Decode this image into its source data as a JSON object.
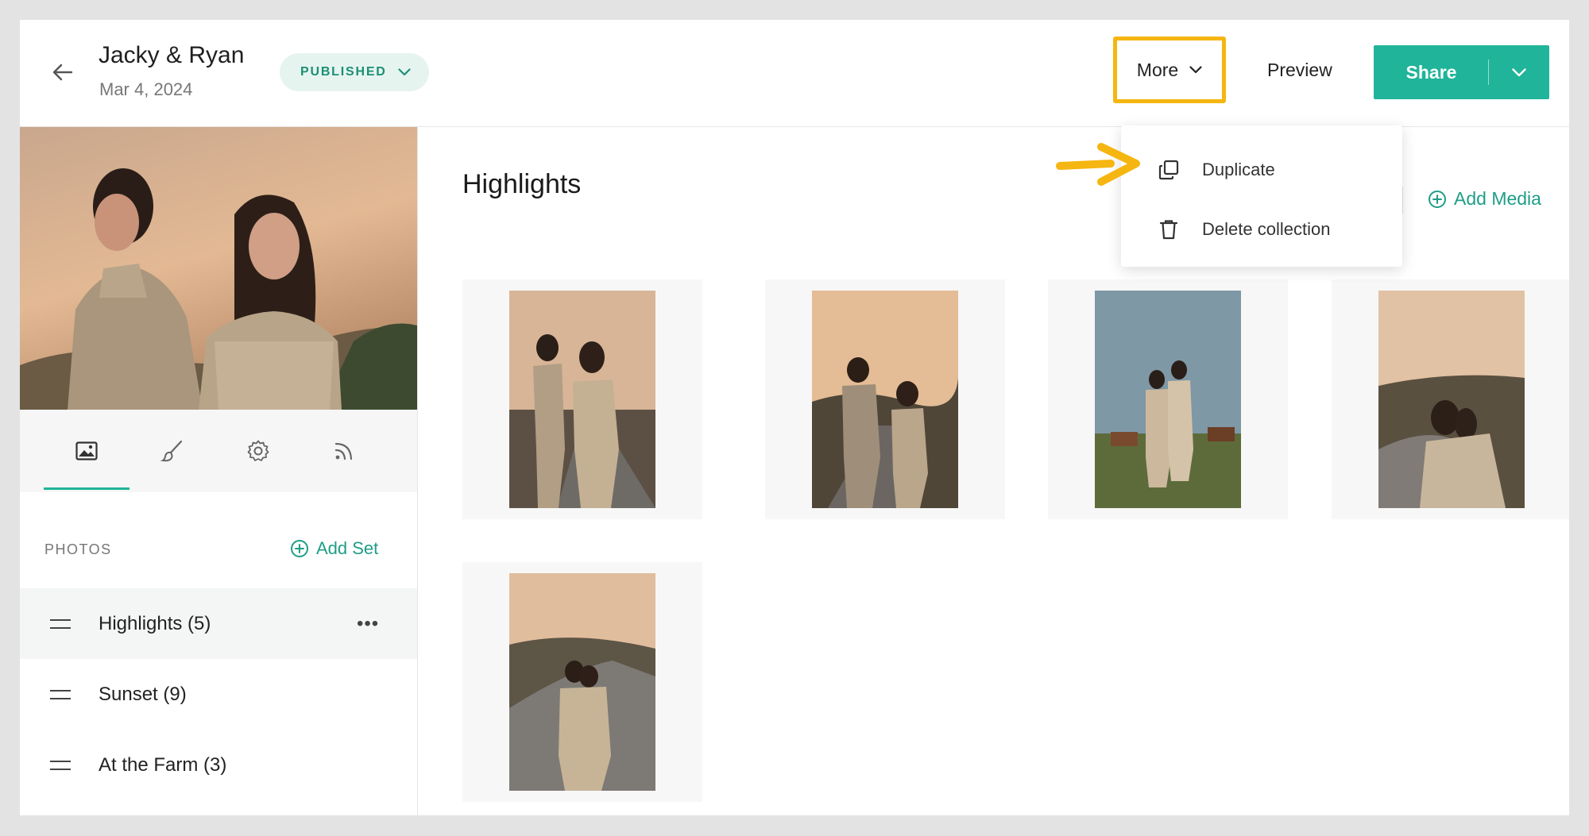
{
  "header": {
    "title": "Jacky & Ryan",
    "date": "Mar 4, 2024",
    "status": "PUBLISHED",
    "more_label": "More",
    "preview_label": "Preview",
    "share_label": "Share"
  },
  "more_menu": {
    "items": [
      {
        "label": "Duplicate",
        "icon": "duplicate-icon"
      },
      {
        "label": "Delete collection",
        "icon": "trash-icon"
      }
    ]
  },
  "sidebar": {
    "tabs": [
      {
        "icon": "photo-icon",
        "active": true
      },
      {
        "icon": "brush-icon",
        "active": false
      },
      {
        "icon": "gear-icon",
        "active": false
      },
      {
        "icon": "rss-icon",
        "active": false
      }
    ],
    "section_label": "PHOTOS",
    "add_set_label": "Add Set",
    "sets": [
      {
        "label": "Highlights (5)",
        "active": true
      },
      {
        "label": "Sunset (9)",
        "active": false
      },
      {
        "label": "At the Farm (3)",
        "active": false
      }
    ]
  },
  "main": {
    "title": "Highlights",
    "add_media_label": "Add Media",
    "thumb_count": 5
  },
  "colors": {
    "accent": "#20b49a",
    "highlight": "#f6b611",
    "status_bg": "#e6f4f0"
  }
}
